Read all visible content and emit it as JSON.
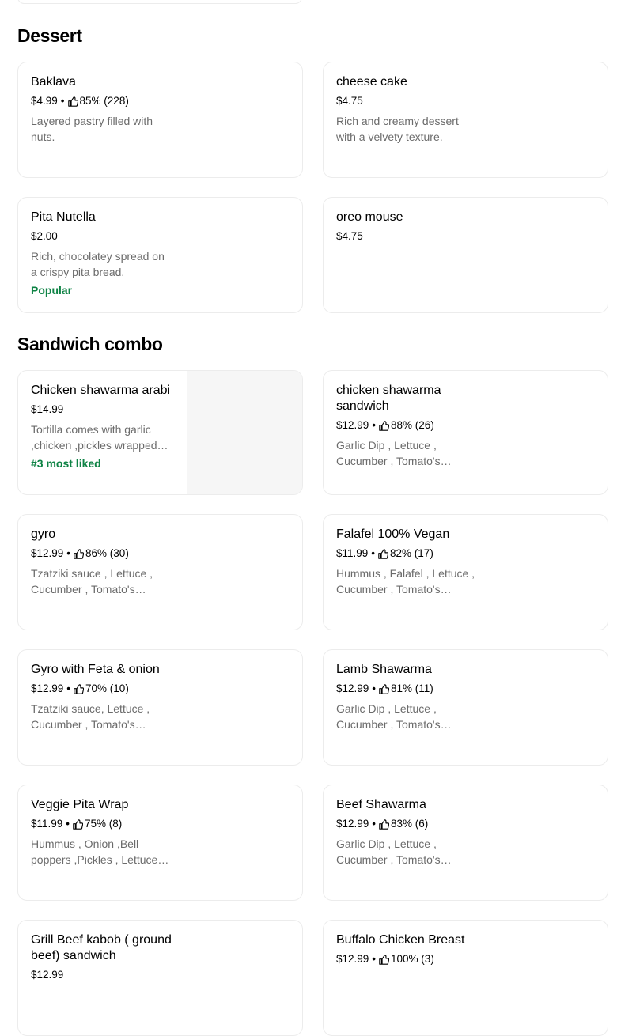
{
  "sections": [
    {
      "title": "Dessert",
      "items": [
        {
          "name": "Baklava",
          "price": "$4.99",
          "rating": "85% (228)",
          "description": "Layered pastry filled with nuts.",
          "badge": ""
        },
        {
          "name": "cheese cake",
          "price": "$4.75",
          "rating": "",
          "description": "Rich and creamy dessert with a velvety texture.",
          "badge": ""
        },
        {
          "name": "Pita Nutella",
          "price": "$2.00",
          "rating": "",
          "description": "Rich, chocolatey spread on a crispy pita bread.",
          "badge": "Popular"
        },
        {
          "name": "oreo mouse",
          "price": "$4.75",
          "rating": "",
          "description": "",
          "badge": ""
        }
      ]
    },
    {
      "title": "Sandwich combo",
      "items": [
        {
          "name": "Chicken shawarma arabi",
          "price": "$14.99",
          "rating": "",
          "description": "Tortilla comes with garlic ,chicken ,pickles wrapped…",
          "badge": "#3 most liked"
        },
        {
          "name": "chicken shawarma sandwich",
          "price": "$12.99",
          "rating": "88% (26)",
          "description": "Garlic Dip , Lettuce , Cucumber , Tomato's…",
          "badge": ""
        },
        {
          "name": "gyro",
          "price": "$12.99",
          "rating": "86% (30)",
          "description": "Tzatziki sauce , Lettuce , Cucumber , Tomato's…",
          "badge": ""
        },
        {
          "name": "Falafel 100% Vegan",
          "price": "$11.99",
          "rating": "82% (17)",
          "description": "Hummus , Falafel , Lettuce , Cucumber , Tomato's…",
          "badge": ""
        },
        {
          "name": "Gyro with Feta & onion",
          "price": "$12.99",
          "rating": "70% (10)",
          "description": "Tzatziki sauce, Lettuce , Cucumber , Tomato's…",
          "badge": ""
        },
        {
          "name": "Lamb Shawarma",
          "price": "$12.99",
          "rating": "81% (11)",
          "description": "Garlic Dip , Lettuce , Cucumber , Tomato's…",
          "badge": ""
        },
        {
          "name": "Veggie Pita Wrap",
          "price": "$11.99",
          "rating": "75% (8)",
          "description": "Hummus , Onion ,Bell poppers ,Pickles , Lettuce ,…",
          "badge": ""
        },
        {
          "name": "Beef Shawarma",
          "price": "$12.99",
          "rating": "83% (6)",
          "description": "Garlic Dip , Lettuce , Cucumber , Tomato's…",
          "badge": ""
        },
        {
          "name": "Grill Beef kabob ( ground beef) sandwich",
          "price": "$12.99",
          "rating": "",
          "description": "",
          "badge": ""
        },
        {
          "name": "Buffalo Chicken Breast",
          "price": "$12.99",
          "rating": "100% (3)",
          "description": "",
          "badge": ""
        }
      ]
    }
  ],
  "separator": "•",
  "icons": {
    "rating": "thumbs-up-icon"
  }
}
